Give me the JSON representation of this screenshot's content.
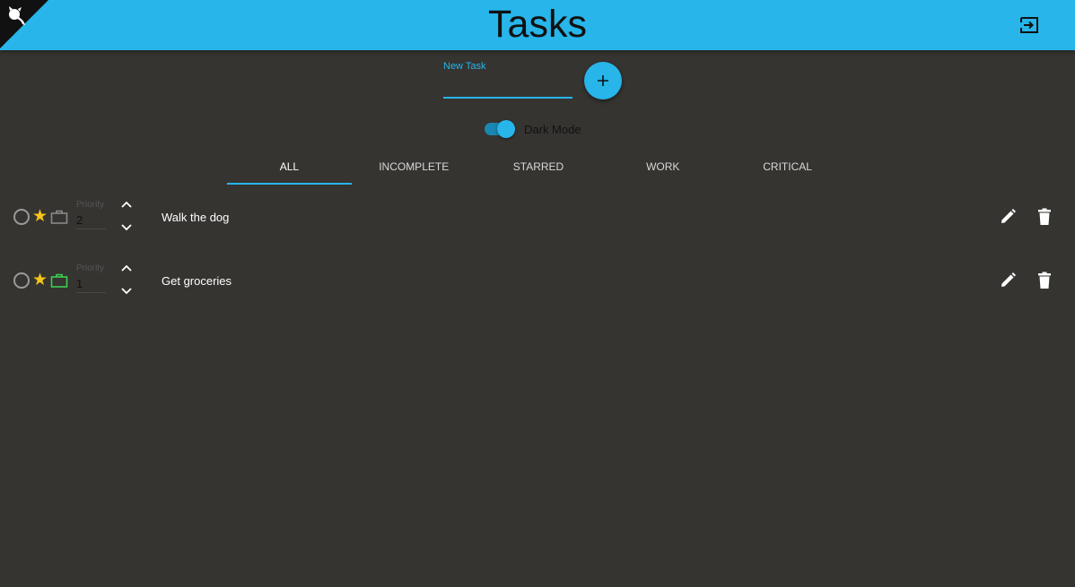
{
  "header": {
    "title": "Tasks"
  },
  "new_task": {
    "label": "New Task",
    "value": ""
  },
  "dark_mode": {
    "label": "Dark Mode",
    "on": true
  },
  "tabs": [
    {
      "label": "ALL",
      "active": true
    },
    {
      "label": "INCOMPLETE",
      "active": false
    },
    {
      "label": "STARRED",
      "active": false
    },
    {
      "label": "WORK",
      "active": false
    },
    {
      "label": "CRITICAL",
      "active": false
    }
  ],
  "tasks": [
    {
      "text": "Walk the dog",
      "priority_label": "Priority",
      "priority": "2",
      "starred": true,
      "work_icon_color": "#8a8a8a"
    },
    {
      "text": "Get groceries",
      "priority_label": "Priority",
      "priority": "1",
      "starred": true,
      "work_icon_color": "#3ccf4e"
    }
  ],
  "colors": {
    "accent": "#27b5ea",
    "background": "#353431",
    "star": "#f5c518"
  },
  "icons": {
    "corner": "octocat-icon",
    "logout": "exit-to-app-icon",
    "add": "plus-icon",
    "complete": "circle-outline-icon",
    "star": "star-icon",
    "work": "briefcase-icon",
    "up": "chevron-up-icon",
    "down": "chevron-down-icon",
    "edit": "pencil-icon",
    "delete": "trash-icon"
  }
}
